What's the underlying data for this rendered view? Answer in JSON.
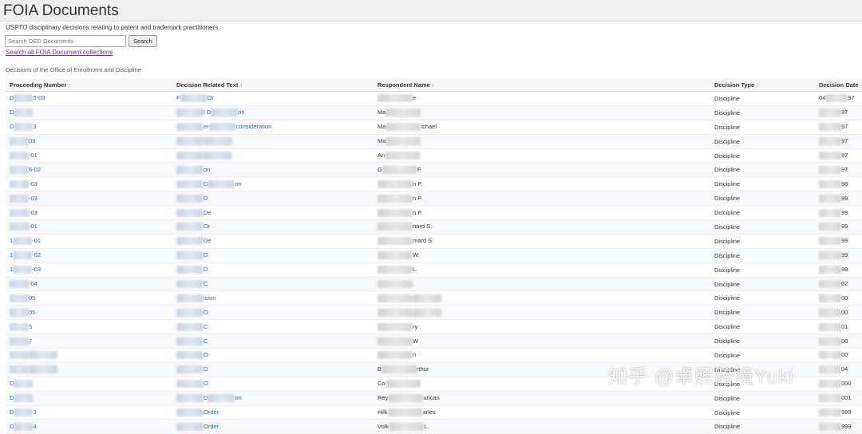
{
  "page": {
    "title": "FOIA Documents",
    "subtitle": "USPTO disciplinary decisions relating to patent and trademark practitioners.",
    "search": {
      "placeholder": "Search OED Documents",
      "button_label": "Search"
    },
    "search_all_link": "Search all FOIA Document collections",
    "caption": "Decisions of the Office of Enrollment and Discipline"
  },
  "table": {
    "columns": [
      {
        "label": "Proceeding Number",
        "sort_icon": "↕"
      },
      {
        "label": "Decision Related Text",
        "sort_icon": "↕"
      },
      {
        "label": "Respondent Name",
        "sort_icon": "↕"
      },
      {
        "label": "Decision Type",
        "sort_icon": "↕"
      },
      {
        "label": "Decision Date",
        "sort_icon": ""
      }
    ],
    "rows": [
      {
        "num": [
          "D",
          "5-03"
        ],
        "text": [
          "F",
          "Or"
        ],
        "name": [
          "",
          "e"
        ],
        "type": "Discipline",
        "date": [
          "04",
          "97"
        ]
      },
      {
        "num": [
          "D",
          ""
        ],
        "text": [
          "",
          "l D",
          "on"
        ],
        "name": [
          "Ma",
          ""
        ],
        "type": "Discipline",
        "date": [
          "",
          "97"
        ]
      },
      {
        "num": [
          "D",
          "3"
        ],
        "text": [
          "",
          "er",
          "consideration"
        ],
        "name": [
          "Ma",
          "ichael"
        ],
        "type": "Discipline",
        "date": [
          "",
          "97"
        ]
      },
      {
        "num": [
          "",
          "03"
        ],
        "text": [
          "",
          ""
        ],
        "name": [
          "Ma",
          ""
        ],
        "type": "Discipline",
        "date": [
          "",
          "97"
        ]
      },
      {
        "num": [
          "",
          "-01"
        ],
        "text": [
          "",
          ""
        ],
        "name": [
          "An",
          ""
        ],
        "type": "Discipline",
        "date": [
          "",
          "97"
        ]
      },
      {
        "num": [
          "",
          "6-02"
        ],
        "text": [
          "",
          "on"
        ],
        "name": [
          "G",
          "F."
        ],
        "type": "Discipline",
        "date": [
          "",
          "97"
        ]
      },
      {
        "num": [
          "",
          "-03"
        ],
        "text": [
          "",
          "D",
          "on"
        ],
        "name": [
          "",
          "n P."
        ],
        "type": "Discipline",
        "date": [
          "",
          "98"
        ]
      },
      {
        "num": [
          "",
          "-03"
        ],
        "text": [
          "",
          "D"
        ],
        "name": [
          "",
          "n P."
        ],
        "type": "Discipline",
        "date": [
          "",
          "99"
        ]
      },
      {
        "num": [
          "",
          "-03"
        ],
        "text": [
          "",
          "De"
        ],
        "name": [
          "",
          "n P."
        ],
        "type": "Discipline",
        "date": [
          "",
          "99"
        ]
      },
      {
        "num": [
          "",
          "-01"
        ],
        "text": [
          "",
          "Or"
        ],
        "name": [
          "",
          "nard S."
        ],
        "type": "Discipline",
        "date": [
          "",
          "99"
        ]
      },
      {
        "num": [
          "1",
          "-01"
        ],
        "text": [
          "",
          "De"
        ],
        "name": [
          "",
          "mard S."
        ],
        "type": "Discipline",
        "date": [
          "",
          "99"
        ]
      },
      {
        "num": [
          "1",
          "-02"
        ],
        "text": [
          "",
          "D"
        ],
        "name": [
          "",
          "W."
        ],
        "type": "Discipline",
        "date": [
          "",
          "99"
        ]
      },
      {
        "num": [
          "1",
          "-03"
        ],
        "text": [
          "",
          "D"
        ],
        "name": [
          "",
          "L."
        ],
        "type": "Discipline",
        "date": [
          "",
          "99"
        ]
      },
      {
        "num": [
          "",
          "-04"
        ],
        "text": [
          "",
          "C"
        ],
        "name": [
          "",
          "."
        ],
        "type": "Discipline",
        "date": [
          "",
          "02"
        ]
      },
      {
        "num": [
          "",
          "05"
        ],
        "text": [
          "",
          "ision"
        ],
        "name": [
          "",
          ""
        ],
        "type": "Discipline",
        "date": [
          "",
          "00"
        ]
      },
      {
        "num": [
          "",
          "05"
        ],
        "text": [
          "",
          "O"
        ],
        "name": [
          "",
          ""
        ],
        "type": "Discipline",
        "date": [
          "",
          "00"
        ]
      },
      {
        "num": [
          "",
          "5"
        ],
        "text": [
          "",
          "C"
        ],
        "name": [
          "",
          "ry"
        ],
        "type": "Discipline",
        "date": [
          "",
          "01"
        ]
      },
      {
        "num": [
          "",
          "7"
        ],
        "text": [
          "",
          "C"
        ],
        "name": [
          "",
          "W"
        ],
        "type": "Discipline",
        "date": [
          "",
          "00"
        ]
      },
      {
        "num": [
          "",
          ""
        ],
        "text": [
          "",
          "O"
        ],
        "name": [
          "",
          "n"
        ],
        "type": "Discipline",
        "date": [
          "",
          "00"
        ]
      },
      {
        "num": [
          "",
          ""
        ],
        "text": [
          "",
          "D"
        ],
        "name": [
          "B",
          "rthur"
        ],
        "type": "Discipline",
        "date": [
          "",
          "04"
        ]
      },
      {
        "num": [
          "D",
          ""
        ],
        "text": [
          "",
          "O"
        ],
        "name": [
          "Co",
          ""
        ],
        "type": "Discipline",
        "date": [
          "",
          "000"
        ]
      },
      {
        "num": [
          "D",
          ""
        ],
        "text": [
          "",
          "D",
          "on"
        ],
        "name": [
          "Rey",
          "uncan"
        ],
        "type": "Discipline",
        "date": [
          "",
          "001"
        ]
      },
      {
        "num": [
          "D",
          "3"
        ],
        "text": [
          "",
          "Order"
        ],
        "name": [
          "Hilk",
          "arles"
        ],
        "type": "Discipline",
        "date": [
          "",
          "999"
        ]
      },
      {
        "num": [
          "D",
          "4"
        ],
        "text": [
          "",
          "Order"
        ],
        "name": [
          "Volk",
          "L."
        ],
        "type": "Discipline",
        "date": [
          "",
          "999"
        ]
      }
    ]
  },
  "watermark": "知乎 @卓照跨境Yuki"
}
